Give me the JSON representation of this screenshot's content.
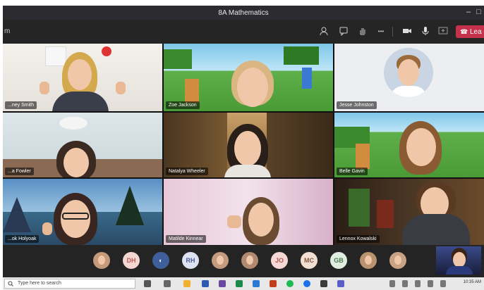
{
  "window": {
    "title": "8A Mathematics",
    "minimize": "–",
    "maximize": "□"
  },
  "toolbar": {
    "left_text": "m",
    "icons": [
      "people-icon",
      "chat-icon",
      "raise-hand-icon",
      "more-icon",
      "camera-icon",
      "mic-icon",
      "share-screen-icon"
    ],
    "more_label": "•••",
    "leave_label": "Lea"
  },
  "participants": [
    {
      "name": "...ney Smith"
    },
    {
      "name": "Zoe Jackson"
    },
    {
      "name": "Jesse Johnston"
    },
    {
      "name": "...a Fowler"
    },
    {
      "name": "Natalya Wheeler"
    },
    {
      "name": "Belle Gavin"
    },
    {
      "name": "...ok Holyoak"
    },
    {
      "name": "Matilde Kinnear"
    },
    {
      "name": "Lennox Kowalski"
    }
  ],
  "more_participants": [
    {
      "initials": "",
      "kind": "photo",
      "color": "#c59a7a"
    },
    {
      "initials": "DH",
      "kind": "initials",
      "color": "#f4d6d2",
      "text_color": "#b85c5c"
    },
    {
      "initials": "",
      "kind": "logo",
      "color": "#3f5f9a"
    },
    {
      "initials": "RH",
      "kind": "initials",
      "color": "#dde3f2",
      "text_color": "#4d5f95"
    },
    {
      "initials": "",
      "kind": "photo",
      "color": "#c49a80"
    },
    {
      "initials": "",
      "kind": "photo",
      "color": "#b08a70"
    },
    {
      "initials": "JO",
      "kind": "initials",
      "color": "#f6d9d4",
      "text_color": "#b05a4e"
    },
    {
      "initials": "MC",
      "kind": "initials",
      "color": "#f1dfd2",
      "text_color": "#8a5a44"
    },
    {
      "initials": "GB",
      "kind": "initials",
      "color": "#dfeee0",
      "text_color": "#4d7a52"
    },
    {
      "initials": "",
      "kind": "photo",
      "color": "#b9926f"
    },
    {
      "initials": "",
      "kind": "photo",
      "color": "#c9a184"
    }
  ],
  "taskbar": {
    "search_placeholder": "Type here to search",
    "clock": "10:35 AM"
  },
  "colors": {
    "leave": "#c4314b",
    "stage": "#111111"
  }
}
